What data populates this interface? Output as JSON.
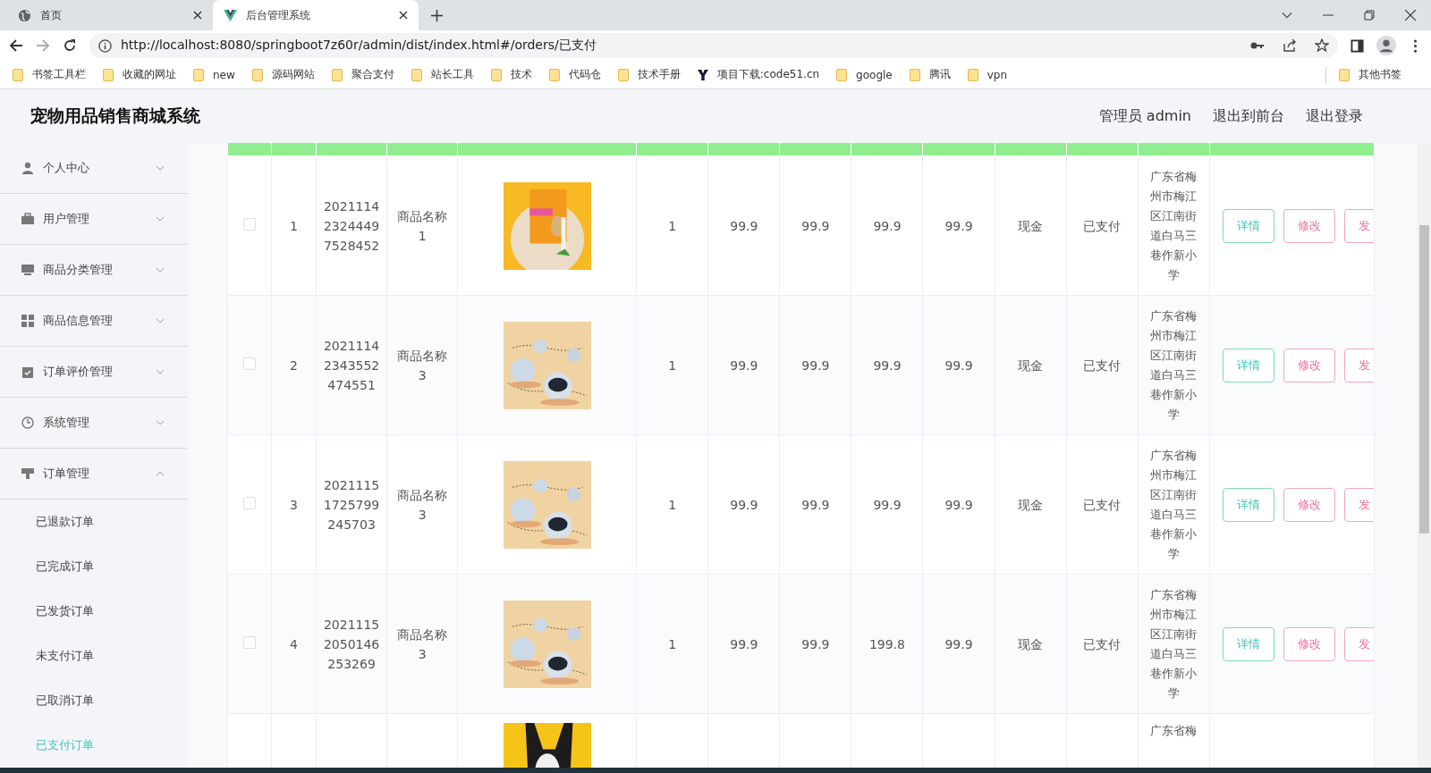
{
  "browser": {
    "tabs": [
      {
        "title": "首页",
        "selected": false
      },
      {
        "title": "后台管理系统",
        "selected": true
      }
    ],
    "url": "http://localhost:8080/springboot7z60r/admin/dist/index.html#/orders/已支付",
    "bookmarks": [
      {
        "label": "书签工具栏",
        "kind": "folder"
      },
      {
        "label": "收藏的网址",
        "kind": "folder"
      },
      {
        "label": "new",
        "kind": "folder"
      },
      {
        "label": "源码网站",
        "kind": "folder"
      },
      {
        "label": "聚合支付",
        "kind": "folder"
      },
      {
        "label": "站长工具",
        "kind": "folder"
      },
      {
        "label": "技术",
        "kind": "folder"
      },
      {
        "label": "代码仓",
        "kind": "folder"
      },
      {
        "label": "技术手册",
        "kind": "folder"
      },
      {
        "label": "项目下载:code51.cn",
        "kind": "site"
      },
      {
        "label": "google",
        "kind": "folder"
      },
      {
        "label": "腾讯",
        "kind": "folder"
      },
      {
        "label": "vpn",
        "kind": "folder"
      }
    ],
    "other_bookmarks": "其他书签"
  },
  "header": {
    "title": "宠物用品销售商城系统",
    "user": "管理员 admin",
    "links": [
      "退出到前台",
      "退出登录"
    ]
  },
  "sidebar": {
    "items": [
      {
        "label": "个人中心",
        "expanded": false
      },
      {
        "label": "用户管理",
        "expanded": false
      },
      {
        "label": "商品分类管理",
        "expanded": false
      },
      {
        "label": "商品信息管理",
        "expanded": false
      },
      {
        "label": "订单评价管理",
        "expanded": false
      },
      {
        "label": "系统管理",
        "expanded": false
      },
      {
        "label": "订单管理",
        "expanded": true,
        "children": [
          {
            "label": "已退款订单",
            "selected": false
          },
          {
            "label": "已完成订单",
            "selected": false
          },
          {
            "label": "已发货订单",
            "selected": false
          },
          {
            "label": "未支付订单",
            "selected": false
          },
          {
            "label": "已取消订单",
            "selected": false
          },
          {
            "label": "已支付订单",
            "selected": true
          }
        ]
      }
    ]
  },
  "table": {
    "rows": [
      {
        "selected": false,
        "index": "1",
        "order_no": "2021114\n2324449\n7528452",
        "product": "商品名称\n1",
        "quantity": "1",
        "column_7": "99.9",
        "column_8": "99.9",
        "column_9": "99.9",
        "column_10": "99.9",
        "payment": "现金",
        "status": "已支付",
        "address": "广东省梅州市梅江区江南街道白马三巷作新小学",
        "actions": [
          "详情",
          "修改",
          "发"
        ]
      },
      {
        "selected": false,
        "index": "2",
        "order_no": "2021114\n2343552\n474551",
        "product": "商品名称\n3",
        "quantity": "1",
        "column_7": "99.9",
        "column_8": "99.9",
        "column_9": "99.9",
        "column_10": "99.9",
        "payment": "现金",
        "status": "已支付",
        "address": "广东省梅州市梅江区江南街道白马三巷作新小学",
        "actions": [
          "详情",
          "修改",
          "发"
        ]
      },
      {
        "selected": false,
        "index": "3",
        "order_no": "2021115\n1725799\n245703",
        "product": "商品名称\n3",
        "quantity": "1",
        "column_7": "99.9",
        "column_8": "99.9",
        "column_9": "99.9",
        "column_10": "99.9",
        "payment": "现金",
        "status": "已支付",
        "address": "广东省梅州市梅江区江南街道白马三巷作新小学",
        "actions": [
          "详情",
          "修改",
          "发"
        ]
      },
      {
        "selected": false,
        "index": "4",
        "order_no": "2021115\n2050146\n253269",
        "product": "商品名称\n3",
        "quantity": "1",
        "column_7": "99.9",
        "column_8": "99.9",
        "column_9": "199.8",
        "column_10": "99.9",
        "payment": "现金",
        "status": "已支付",
        "address": "广东省梅州市梅江区江南街道白马三巷作新小学",
        "actions": [
          "详情",
          "修改",
          "发"
        ]
      },
      {
        "address": "广东省梅"
      }
    ]
  }
}
